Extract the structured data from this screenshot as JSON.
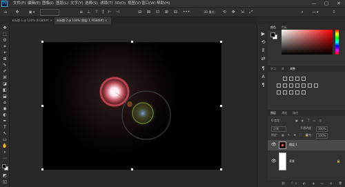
{
  "app": {
    "logo": "Ps"
  },
  "menu": [
    "文件(F)",
    "编辑(E)",
    "图像(I)",
    "图层(L)",
    "文字(Y)",
    "选择(S)",
    "滤镜(T)",
    "3D(D)",
    "视图(V)",
    "窗口(W)",
    "帮助(H)"
  ],
  "window_controls": [
    "—",
    "▢",
    "✕"
  ],
  "options_bar": {
    "home_icon": "home-icon",
    "tool_icon": "move-tool-icon",
    "mode": "▣ ▾",
    "align_icons": "≡ ⊥ ⊤ ⫿ ⊢ ⊣",
    "more": "•••",
    "mode3d": "3D 模式：",
    "search": "⌕",
    "workspace": "▭ ▾",
    "share": "⇪"
  },
  "doc_tabs": [
    {
      "label": "未标题-1 @ 100% (RGB/8#) ×",
      "active": false
    },
    {
      "label": "未标题-2 @ 100% (图层 1, RGB/8#) ×",
      "active": true
    }
  ],
  "tools": [
    "✥",
    "⬚",
    "ʘ",
    "⌗",
    "⌖",
    "⊞",
    "✎",
    "✐",
    "⌘",
    "◪",
    "◧",
    "⬓",
    "⌂",
    "◉",
    "◐",
    "T",
    "↖",
    "▭",
    "✋",
    "⌕",
    "⋯",
    "◩",
    "◱"
  ],
  "colors": {
    "foreground": "#000000",
    "background": "#ffffff",
    "accent": "#31a8ff"
  },
  "side_icons": [
    "▶",
    "⟲",
    "⫴",
    "⇄",
    "¶",
    "A",
    "¶"
  ],
  "color_panel": {
    "tabs": [
      "颜色",
      "色板"
    ]
  },
  "adjustments_panel": {
    "tabs": [
      "学习",
      "库",
      "调整"
    ]
  },
  "layers_panel": {
    "tabs": [
      "图层",
      "通道",
      "路径"
    ],
    "filter_label": "Q 类型",
    "blend_mode": "正常",
    "opacity_label": "不透明度：",
    "opacity_value": "100%",
    "lock_label": "锁定：",
    "fill_label": "填充：",
    "fill_value": "100%",
    "layers": [
      {
        "name": "图层 1",
        "visible": true,
        "selected": true
      },
      {
        "name": "背景",
        "visible": true,
        "selected": false
      }
    ]
  }
}
